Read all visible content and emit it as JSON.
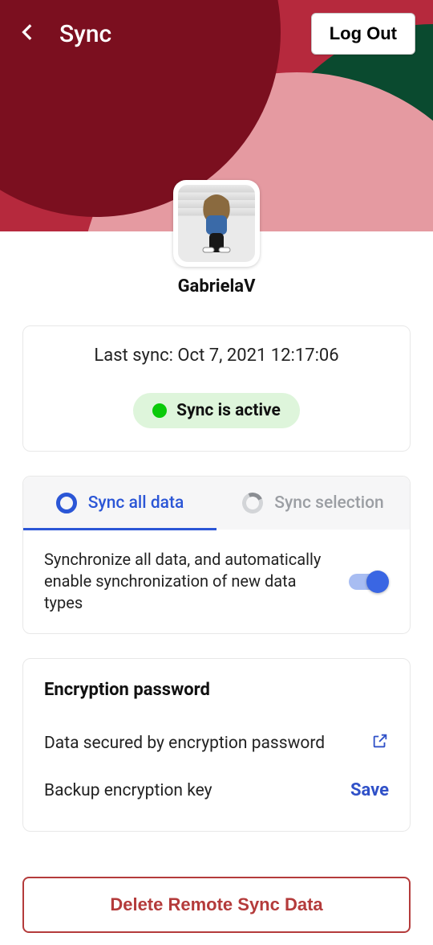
{
  "header": {
    "title": "Sync",
    "logout_label": "Log Out"
  },
  "user": {
    "name": "GabrielaV"
  },
  "sync_status": {
    "last_sync_text": "Last sync: Oct 7, 2021 12:17:06",
    "status_label": "Sync is active"
  },
  "tabs": {
    "sync_all_label": "Sync all data",
    "sync_selection_label": "Sync selection"
  },
  "sync_all": {
    "description": "Synchronize all data, and automatically enable synchronization of new data types"
  },
  "encryption": {
    "title": "Encryption password",
    "secured_label": "Data secured by encryption password",
    "backup_label": "Backup encryption key",
    "save_label": "Save"
  },
  "actions": {
    "delete_remote_label": "Delete Remote Sync Data"
  }
}
